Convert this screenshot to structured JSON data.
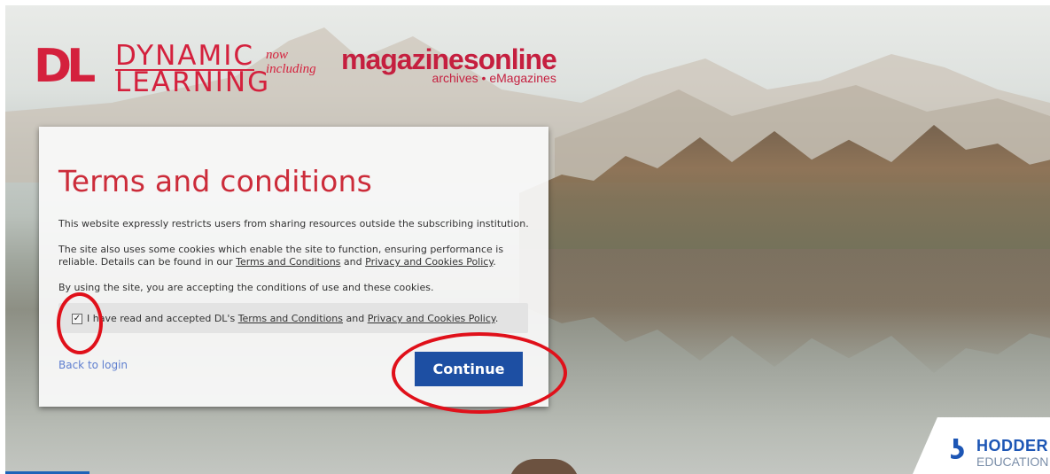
{
  "brand": {
    "dl_mark": "DL",
    "dl_word_top": "DYNAMIC",
    "dl_word_bottom": "LEARNING",
    "now_including": "now including",
    "magazines_title": "magazinesonline",
    "magazines_sub": "archives • eMagazines",
    "hodder_mark": "ʖ",
    "hodder_name": "HODDER",
    "hodder_sub": "EDUCATION"
  },
  "panel": {
    "title": "Terms and conditions",
    "paragraph_1": "This website expressly restricts users from sharing resources outside the subscribing institution.",
    "paragraph_2_text_1": "The site also uses some cookies which enable the site to function, ensuring performance is reliable. Details can be found in our ",
    "paragraph_2_link_1": "Terms and Conditions",
    "paragraph_2_text_2": " and ",
    "paragraph_2_link_2": "Privacy and Cookies Policy",
    "paragraph_2_text_3": ".",
    "paragraph_3": "By using the site, you are accepting the conditions of use and these cookies.",
    "checkbox_checked": true,
    "accept_text_1": "I have read and accepted DL's ",
    "accept_link_1": "Terms and Conditions",
    "accept_text_2": " and ",
    "accept_link_2": "Privacy and Cookies Policy",
    "accept_text_3": ".",
    "back_link": "Back to login",
    "continue_label": "Continue"
  },
  "colors": {
    "brand_red": "#d4213d",
    "title_red": "#cc2c3a",
    "button_blue": "#1d4fa3",
    "link_blue": "#5f7fcf",
    "annotation_red": "#e0101a",
    "hodder_blue": "#1d56b5"
  }
}
